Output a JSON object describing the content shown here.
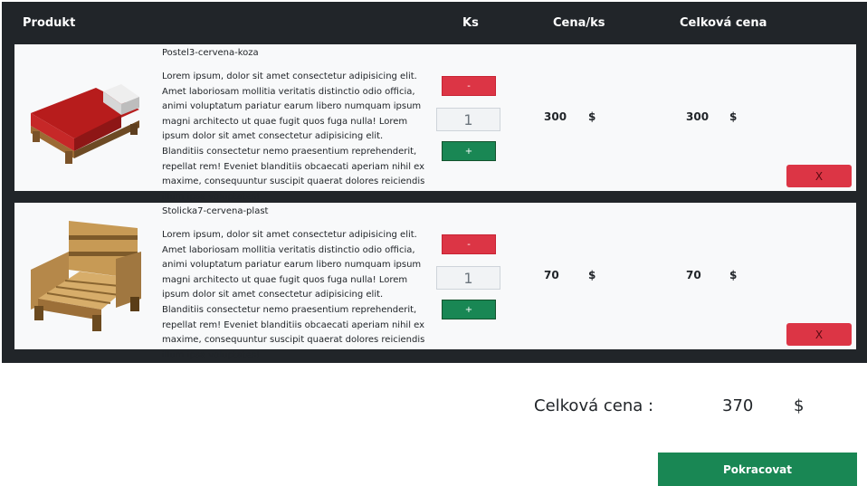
{
  "header": {
    "produkt": "Produkt",
    "ks": "Ks",
    "cena_ks": "Cena/ks",
    "celkova_cena": "Celková cena"
  },
  "items": [
    {
      "name": "Postel3-cervena-koza",
      "description": "Lorem ipsum, dolor sit amet consectetur adipisicing elit. Amet laboriosam mollitia veritatis distinctio odio officia, animi voluptatum pariatur earum libero numquam ipsum magni architecto ut quae fugit quos fuga nulla! Lorem ipsum dolor sit amet consectetur adipisicing elit. Blanditiis consectetur nemo praesentium reprehenderit, repellat rem! Eveniet blanditiis obcaecati aperiam nihil ex maxime, consequuntur suscipit quaerat dolores reiciendis illum ipsa voluptates!",
      "minus_label": "-",
      "quantity": "1",
      "plus_label": "+",
      "unit_price": "300",
      "unit_currency": "$",
      "total_price": "300",
      "total_currency": "$",
      "remove_label": "X",
      "image_icon": "bed-icon"
    },
    {
      "name": "Stolicka7-cervena-plast",
      "description": "Lorem ipsum, dolor sit amet consectetur adipisicing elit. Amet laboriosam mollitia veritatis distinctio odio officia, animi voluptatum pariatur earum libero numquam ipsum magni architecto ut quae fugit quos fuga nulla! Lorem ipsum dolor sit amet consectetur adipisicing elit. Blanditiis consectetur nemo praesentium reprehenderit, repellat rem! Eveniet blanditiis obcaecati aperiam nihil ex maxime, consequuntur suscipit quaerat dolores reiciendis illum ipsa voluptates!",
      "minus_label": "-",
      "quantity": "1",
      "plus_label": "+",
      "unit_price": "70",
      "unit_currency": "$",
      "total_price": "70",
      "total_currency": "$",
      "remove_label": "X",
      "image_icon": "chair-icon"
    }
  ],
  "summary": {
    "label": "Celková cena :",
    "value": "370",
    "currency": "$"
  },
  "continue_label": "Pokracovat",
  "colors": {
    "panel": "#212529",
    "row": "#f8f9fa",
    "danger": "#dc3545",
    "success": "#198754"
  }
}
